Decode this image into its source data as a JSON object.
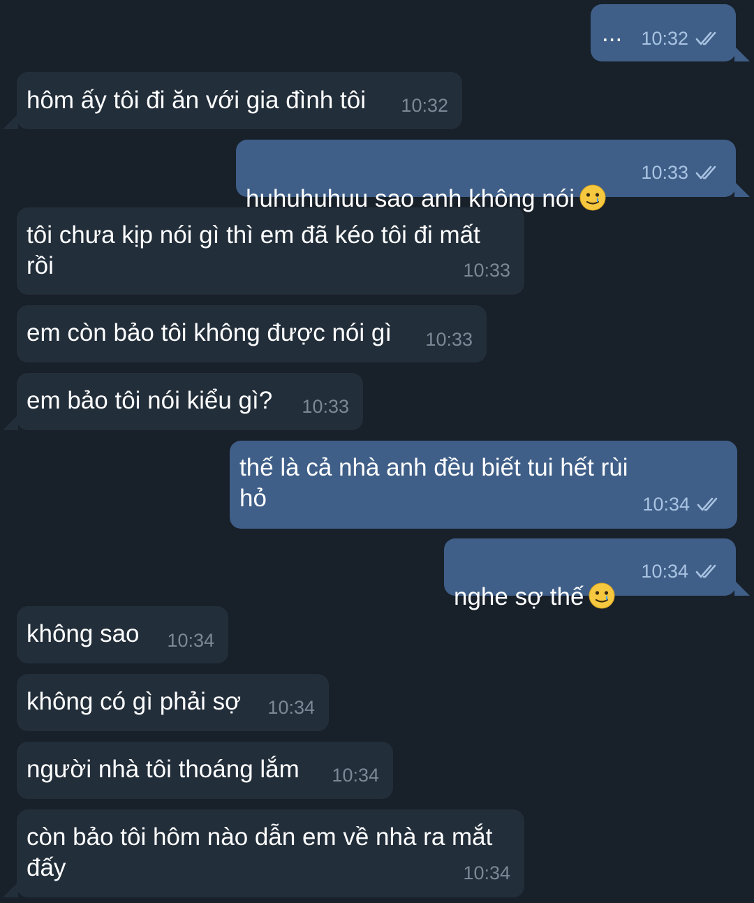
{
  "messages": [
    {
      "text": "...",
      "time": "10:32"
    },
    {
      "text": "hôm ấy tôi đi ăn với gia đình tôi",
      "time": "10:32"
    },
    {
      "text": "huhuhuhuu sao anh không nói",
      "time": "10:33",
      "emoji": "crying-smile-emoji"
    },
    {
      "text": "tôi chưa kịp nói gì thì em đã kéo tôi đi mất\nrồi",
      "time": "10:33"
    },
    {
      "text": "em còn bảo tôi không được nói gì",
      "time": "10:33"
    },
    {
      "text": "em bảo tôi nói kiểu gì?",
      "time": "10:33"
    },
    {
      "text": "thế là cả nhà anh đều biết tui hết rùi\nhỏ",
      "time": "10:34"
    },
    {
      "text": "nghe sợ thế",
      "time": "10:34",
      "emoji": "crying-smile-emoji"
    },
    {
      "text": "không sao",
      "time": "10:34"
    },
    {
      "text": "không có gì phải sợ",
      "time": "10:34"
    },
    {
      "text": "người nhà tôi thoáng lắm",
      "time": "10:34"
    },
    {
      "text": "còn bảo tôi hôm nào dẫn em về nhà ra mắt\nđấy",
      "time": "10:34"
    }
  ],
  "colors": {
    "background": "#18202a",
    "incoming_bubble": "#222e3a",
    "outgoing_bubble": "#3f5f88",
    "incoming_time": "#7b8896",
    "outgoing_time": "#a9c3e2"
  },
  "icons": {
    "read_receipt": "double-check-icon"
  }
}
